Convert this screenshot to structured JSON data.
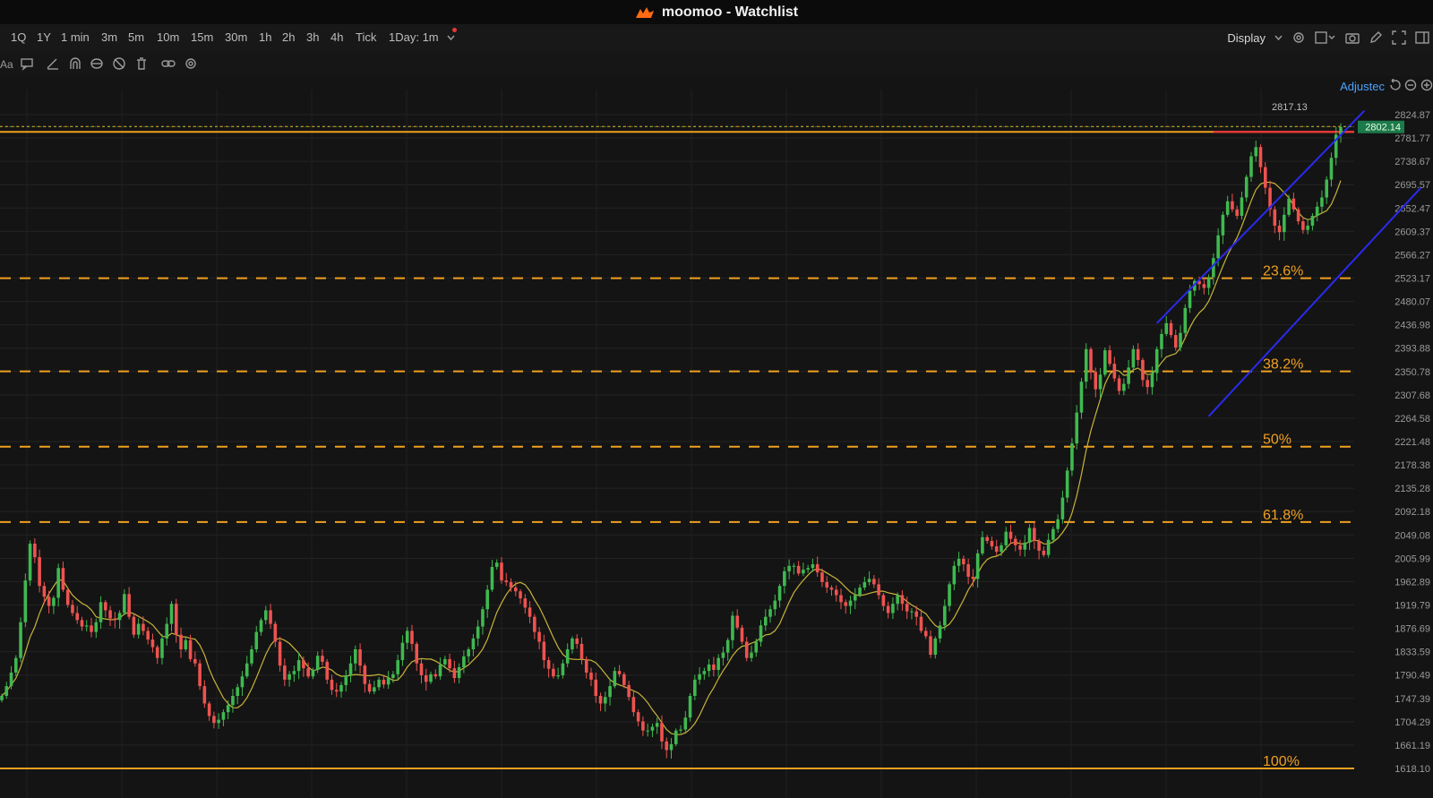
{
  "window": {
    "title": "moomoo - Watchlist"
  },
  "toolbar": {
    "timeframes": [
      "1Q",
      "1Y",
      "1 min",
      "3m",
      "5m",
      "10m",
      "15m",
      "30m",
      "1h",
      "2h",
      "3h",
      "4h",
      "Tick",
      "1Day: 1m"
    ],
    "display_label": "Display"
  },
  "adjust_label": "Adjustec",
  "icons": {
    "drawbar": [
      "text-icon",
      "comment-icon",
      "pen-icon",
      "magnet-icon",
      "lock-icon",
      "hide-icon",
      "trash-icon",
      "link-icon",
      "settings-icon"
    ],
    "toolbar_right": [
      "gear-icon",
      "layout-icon",
      "camera-icon",
      "pencil-icon",
      "fullscreen-icon",
      "panel-icon"
    ]
  },
  "colors": {
    "up": "#3fb950",
    "down": "#ef5350",
    "fib": "#f0a020",
    "channel": "#2a2af0",
    "resistance": "#e53935",
    "price_tag": "#1d7a4a",
    "ma": "#c8b43a"
  },
  "chart_data": {
    "type": "candlestick",
    "y_axis_ticks": [
      2824.87,
      2781.77,
      2738.67,
      2695.57,
      2652.47,
      2609.37,
      2566.27,
      2523.17,
      2480.07,
      2436.98,
      2393.88,
      2350.78,
      2307.68,
      2264.58,
      2221.48,
      2178.38,
      2135.28,
      2092.18,
      2049.08,
      2005.99,
      1962.89,
      1919.79,
      1876.69,
      1833.59,
      1790.49,
      1747.39,
      1704.29,
      1661.19,
      1618.1
    ],
    "ylim": [
      1605,
      2855
    ],
    "high_label": "2817.13",
    "last_price": "2802.14",
    "resistance": 2793,
    "fib_levels": [
      {
        "label": "23.6%",
        "value": 2523
      },
      {
        "label": "38.2%",
        "value": 2351
      },
      {
        "label": "50%",
        "value": 2212
      },
      {
        "label": "61.8%",
        "value": 2073
      },
      {
        "label": "100%",
        "value": 1618
      }
    ],
    "channel": {
      "upper": [
        {
          "bar": 245,
          "price": 2440
        },
        {
          "bar": 289,
          "price": 2832
        }
      ],
      "lower": [
        {
          "bar": 256,
          "price": 2268
        },
        {
          "bar": 301,
          "price": 2690
        }
      ]
    },
    "closes": [
      1752,
      1770,
      1795,
      1822,
      1888,
      1965,
      2033,
      2008,
      1955,
      1935,
      1918,
      1933,
      1988,
      1948,
      1920,
      1905,
      1892,
      1880,
      1882,
      1870,
      1888,
      1925,
      1910,
      1895,
      1892,
      1905,
      1940,
      1898,
      1865,
      1885,
      1872,
      1856,
      1842,
      1822,
      1858,
      1885,
      1922,
      1865,
      1838,
      1855,
      1820,
      1812,
      1770,
      1738,
      1715,
      1702,
      1708,
      1722,
      1735,
      1752,
      1768,
      1788,
      1812,
      1838,
      1870,
      1892,
      1910,
      1885,
      1852,
      1808,
      1782,
      1792,
      1798,
      1818,
      1803,
      1788,
      1800,
      1826,
      1815,
      1782,
      1763,
      1760,
      1772,
      1790,
      1812,
      1838,
      1808,
      1774,
      1760,
      1768,
      1782,
      1773,
      1785,
      1792,
      1818,
      1850,
      1872,
      1848,
      1812,
      1790,
      1778,
      1792,
      1788,
      1810,
      1820,
      1803,
      1785,
      1805,
      1825,
      1838,
      1858,
      1880,
      1912,
      1948,
      1990,
      1998,
      1965,
      1962,
      1952,
      1945,
      1932,
      1915,
      1898,
      1870,
      1852,
      1818,
      1802,
      1788,
      1790,
      1812,
      1838,
      1858,
      1848,
      1820,
      1795,
      1782,
      1752,
      1738,
      1750,
      1770,
      1798,
      1792,
      1772,
      1750,
      1722,
      1705,
      1688,
      1688,
      1695,
      1702,
      1668,
      1652,
      1663,
      1688,
      1690,
      1712,
      1752,
      1782,
      1792,
      1798,
      1810,
      1800,
      1822,
      1832,
      1855,
      1900,
      1878,
      1852,
      1822,
      1832,
      1852,
      1882,
      1898,
      1912,
      1928,
      1955,
      1982,
      1992,
      1992,
      1978,
      1985,
      1988,
      1995,
      1980,
      1962,
      1952,
      1948,
      1938,
      1925,
      1918,
      1928,
      1938,
      1952,
      1962,
      1968,
      1958,
      1938,
      1918,
      1905,
      1922,
      1938,
      1922,
      1908,
      1908,
      1898,
      1872,
      1862,
      1828,
      1858,
      1882,
      1918,
      1958,
      1992,
      2005,
      1995,
      1972,
      1968,
      2015,
      2045,
      2038,
      2028,
      2018,
      2030,
      2055,
      2042,
      2030,
      2022,
      2035,
      2062,
      2038,
      2020,
      2012,
      2040,
      2060,
      2078,
      2118,
      2168,
      2218,
      2275,
      2332,
      2392,
      2350,
      2318,
      2345,
      2390,
      2365,
      2338,
      2315,
      2328,
      2358,
      2392,
      2372,
      2335,
      2322,
      2348,
      2392,
      2420,
      2440,
      2418,
      2395,
      2422,
      2468,
      2500,
      2518,
      2512,
      2505,
      2525,
      2560,
      2602,
      2640,
      2665,
      2650,
      2638,
      2672,
      2710,
      2748,
      2765,
      2728,
      2690,
      2650,
      2620,
      2608,
      2640,
      2670,
      2650,
      2628,
      2612,
      2620,
      2638,
      2655,
      2672,
      2705,
      2745,
      2788,
      2802
    ]
  }
}
